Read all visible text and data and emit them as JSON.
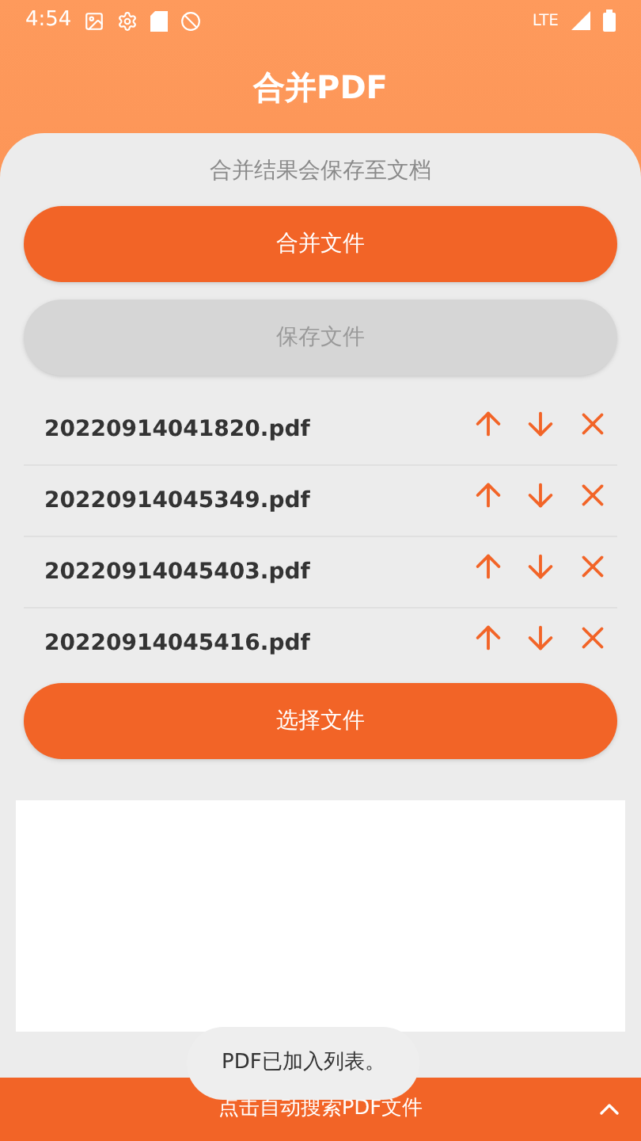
{
  "status_bar": {
    "time": "4:54",
    "network": "LTE"
  },
  "header": {
    "title": "合并PDF"
  },
  "hint": "合并结果会保存至文档",
  "merge_button": {
    "label": "合并文件",
    "disabled": false
  },
  "save_button": {
    "label": "保存文件",
    "disabled": true
  },
  "files": [
    {
      "name": "20220914041820.pdf"
    },
    {
      "name": "20220914045349.pdf"
    },
    {
      "name": "20220914045403.pdf"
    },
    {
      "name": "20220914045416.pdf"
    }
  ],
  "select_button": {
    "label": "选择文件",
    "disabled": false
  },
  "toast": "PDF已加入列表。",
  "bottom_bar": {
    "label": "点击自动搜索PDF文件"
  }
}
